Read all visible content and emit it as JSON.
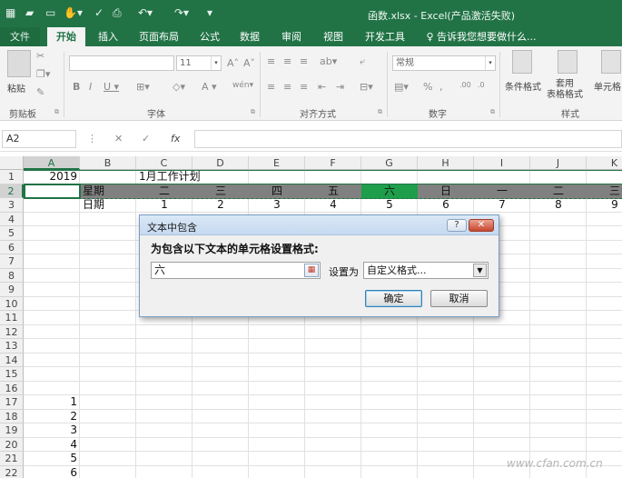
{
  "app": {
    "title": "函数.xlsx - Excel(产品激活失败)",
    "quick_access": [
      "save-icon",
      "open-icon",
      "new-icon",
      "touch-mode-icon",
      "spellcheck-icon",
      "print-preview-icon",
      "undo-icon",
      "redo-icon",
      "customize-icon"
    ],
    "accent": "#217346"
  },
  "tabs": [
    {
      "label": "文件"
    },
    {
      "label": "开始"
    },
    {
      "label": "插入"
    },
    {
      "label": "页面布局"
    },
    {
      "label": "公式"
    },
    {
      "label": "数据"
    },
    {
      "label": "审阅"
    },
    {
      "label": "视图"
    },
    {
      "label": "开发工具"
    },
    {
      "label": "♀ 告诉我您想要做什么..."
    }
  ],
  "ribbon": {
    "clipboard": {
      "paste_label": "粘贴",
      "group_label": "剪贴板"
    },
    "font": {
      "name_value": "",
      "size_value": "11",
      "group_label": "字体"
    },
    "alignment": {
      "group_label": "对齐方式"
    },
    "number": {
      "format_value": "常规",
      "group_label": "数字"
    },
    "styles": {
      "conditional_label": "条件格式",
      "table_label": "套用\n表格格式",
      "cell_label": "单元格",
      "group_label": "样式"
    }
  },
  "formula_bar": {
    "name_box": "A2",
    "fx_label": "fx",
    "value": ""
  },
  "sheet": {
    "columns": [
      "A",
      "B",
      "C",
      "D",
      "E",
      "F",
      "G",
      "H",
      "I",
      "J",
      "K"
    ],
    "rows": [
      "1",
      "2",
      "3",
      "4",
      "5",
      "6",
      "7",
      "8",
      "9",
      "10",
      "11",
      "12",
      "13",
      "14",
      "15",
      "16",
      "17",
      "18",
      "19",
      "20",
      "21",
      "22"
    ],
    "cells": {
      "A1": "2019",
      "C1": "1月工作计划",
      "B2": "星期",
      "C2": "二",
      "D2": "三",
      "E2": "四",
      "F2": "五",
      "G2": "六",
      "H2": "日",
      "I2": "一",
      "J2": "二",
      "K2": "三",
      "B3": "日期",
      "C3": "1",
      "D3": "2",
      "E3": "3",
      "F3": "4",
      "G3": "5",
      "H3": "6",
      "I3": "7",
      "J3": "8",
      "K3": "9",
      "A17": "1",
      "A18": "2",
      "A19": "3",
      "A20": "4",
      "A21": "5",
      "A22": "6"
    },
    "colors": {
      "row2_fill": "#808080",
      "highlight_fill": "#1e9e4a",
      "header_bg": "#f0f0f0"
    }
  },
  "dialog": {
    "title": "文本中包含",
    "help_label": "?",
    "close_label": "✕",
    "prompt": "为包含以下文本的单元格设置格式:",
    "text_value": "六",
    "set_as_label": "设置为",
    "format_value": "自定义格式...",
    "ok_label": "确定",
    "cancel_label": "取消"
  },
  "watermark": "www.cfan.com.cn"
}
